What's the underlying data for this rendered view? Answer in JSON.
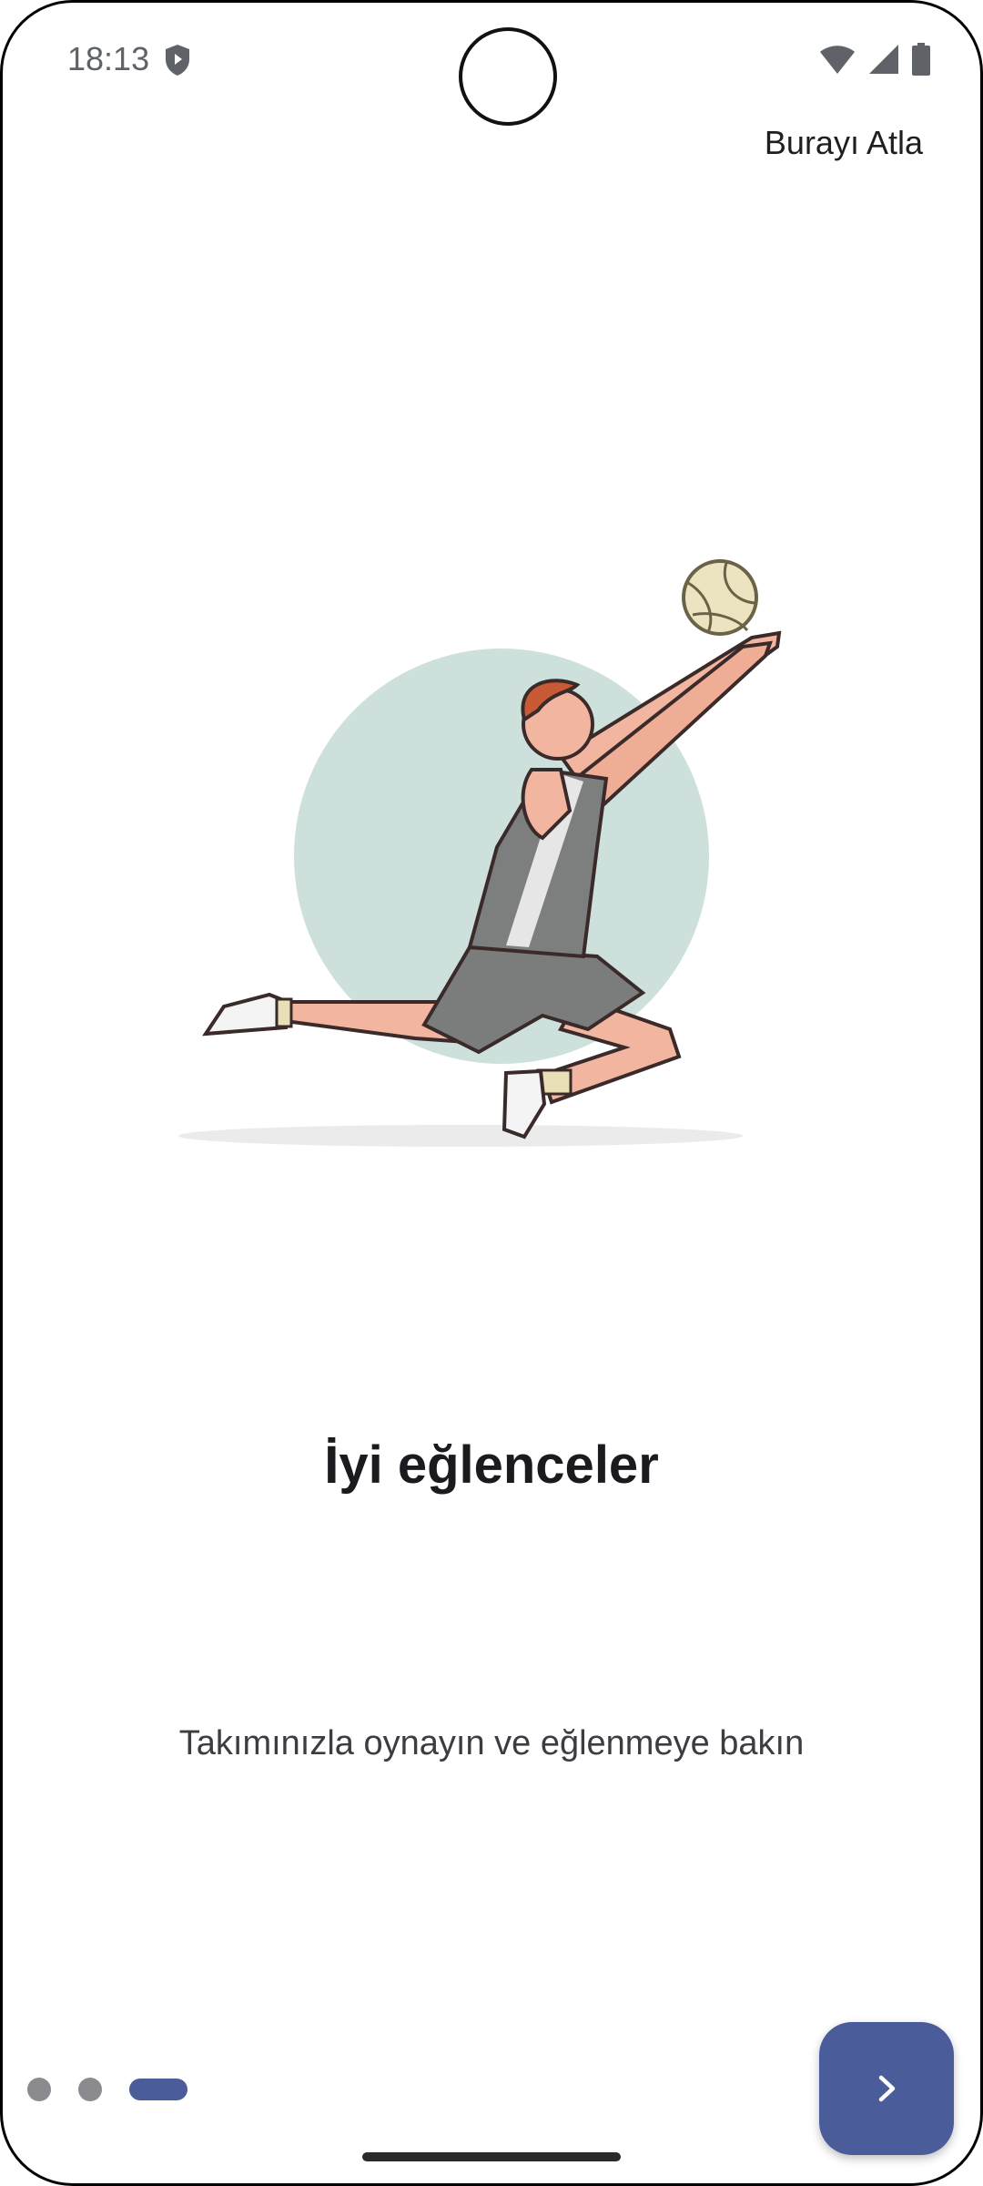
{
  "status_bar": {
    "time": "18:13",
    "icons": [
      "shield-icon",
      "wifi-icon",
      "signal-icon",
      "battery-icon"
    ]
  },
  "header": {
    "skip_label": "Burayı Atla"
  },
  "illustration": {
    "description_icon": "volleyball-player-illustration",
    "circle_color": "#cde0db"
  },
  "content": {
    "title": "İyi eğlenceler",
    "subtitle": "Takımınızla oynayın ve eğlenmeye bakın"
  },
  "pager": {
    "total_pages": 3,
    "current_page": 3
  },
  "colors": {
    "accent": "#4a5d9a",
    "dot_inactive": "#8b8b8f"
  }
}
